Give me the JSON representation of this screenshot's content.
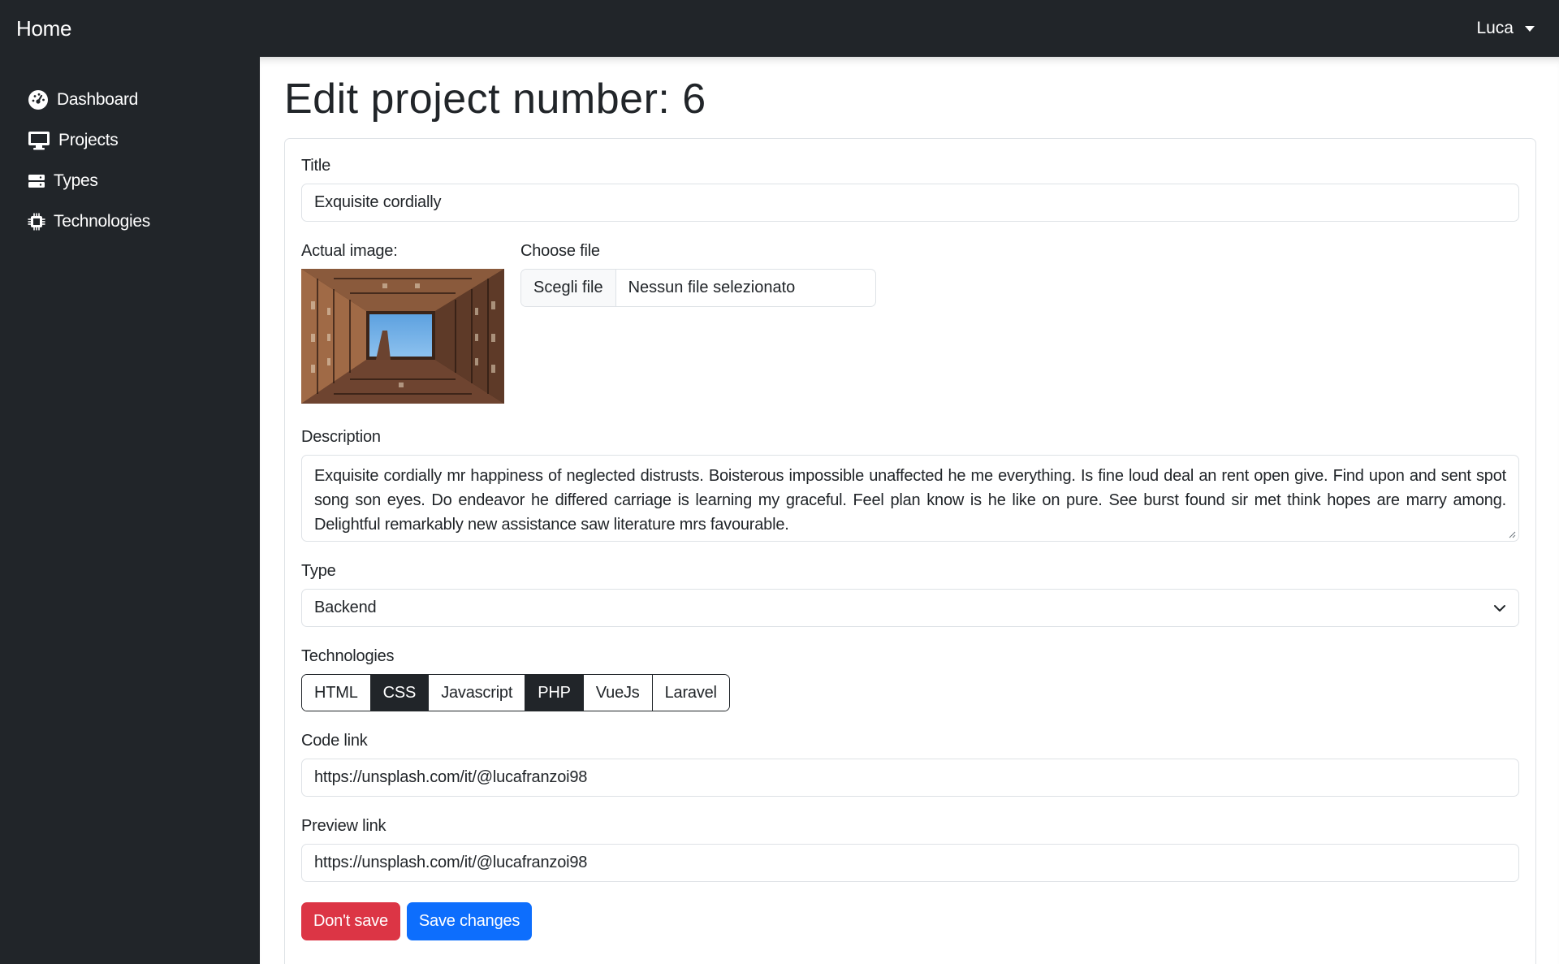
{
  "header": {
    "brand": "Home",
    "user_name": "Luca"
  },
  "sidebar": {
    "items": [
      {
        "label": "Dashboard",
        "icon": "gauge-icon"
      },
      {
        "label": "Projects",
        "icon": "monitor-icon"
      },
      {
        "label": "Types",
        "icon": "server-icon"
      },
      {
        "label": "Technologies",
        "icon": "microchip-icon"
      }
    ]
  },
  "main": {
    "page_title": "Edit project number: 6",
    "form": {
      "title_label": "Title",
      "title_value": "Exquisite cordially",
      "image_label": "Actual image:",
      "file_label": "Choose file",
      "file_button": "Scegli file",
      "file_status": "Nessun file selezionato",
      "description_label": "Description",
      "description_value": "Exquisite cordially mr happiness of neglected distrusts. Boisterous impossible unaffected he me everything. Is fine loud deal an rent open give. Find upon and sent spot song son eyes. Do endeavor he differed carriage is learning my graceful. Feel plan know is he like on pure. See burst found sir met think hopes are marry among. Delightful remarkably new assistance saw literature mrs favourable.",
      "type_label": "Type",
      "type_selected": "Backend",
      "technologies_label": "Technologies",
      "technologies": [
        {
          "label": "HTML",
          "selected": false
        },
        {
          "label": "CSS",
          "selected": true
        },
        {
          "label": "Javascript",
          "selected": false
        },
        {
          "label": "PHP",
          "selected": true
        },
        {
          "label": "VueJs",
          "selected": false
        },
        {
          "label": "Laravel",
          "selected": false
        }
      ],
      "code_link_label": "Code link",
      "code_link_value": "https://unsplash.com/it/@lucafranzoi98",
      "preview_link_label": "Preview link",
      "preview_link_value": "https://unsplash.com/it/@lucafranzoi98",
      "dont_save_button": "Don't save",
      "save_button": "Save changes"
    }
  },
  "colors": {
    "dark": "#212529",
    "danger": "#dc3545",
    "primary": "#0d6efd",
    "border": "#dee2e6"
  }
}
